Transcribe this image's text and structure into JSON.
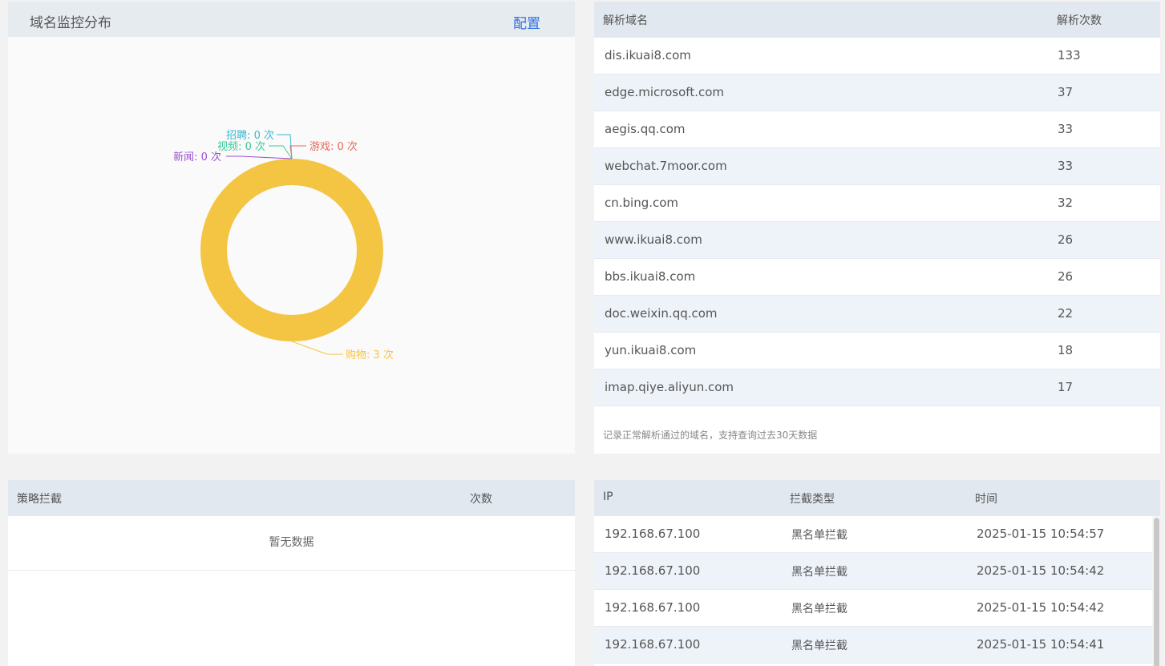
{
  "chart_panel": {
    "title": "域名监控分布",
    "config_label": "配置"
  },
  "chart_data": {
    "type": "pie",
    "donut": true,
    "slices": [
      {
        "name": "购物",
        "value": 3,
        "label": "购物: 3 次",
        "color": "#f4c542"
      },
      {
        "name": "游戏",
        "value": 0,
        "label": "游戏: 0 次",
        "color": "#e8685a"
      },
      {
        "name": "招聘",
        "value": 0,
        "label": "招聘: 0 次",
        "color": "#3bb6d6"
      },
      {
        "name": "视频",
        "value": 0,
        "label": "视频: 0 次",
        "color": "#3cc99a"
      },
      {
        "name": "新闻",
        "value": 0,
        "label": "新闻: 0 次",
        "color": "#9b4fd1"
      }
    ]
  },
  "domain_table": {
    "headers": [
      "解析域名",
      "解析次数"
    ],
    "rows": [
      {
        "domain": "dis.ikuai8.com",
        "count": "133"
      },
      {
        "domain": "edge.microsoft.com",
        "count": "37"
      },
      {
        "domain": "aegis.qq.com",
        "count": "33"
      },
      {
        "domain": "webchat.7moor.com",
        "count": "33"
      },
      {
        "domain": "cn.bing.com",
        "count": "32"
      },
      {
        "domain": "www.ikuai8.com",
        "count": "26"
      },
      {
        "domain": "bbs.ikuai8.com",
        "count": "26"
      },
      {
        "domain": "doc.weixin.qq.com",
        "count": "22"
      },
      {
        "domain": "yun.ikuai8.com",
        "count": "18"
      },
      {
        "domain": "imap.qiye.aliyun.com",
        "count": "17"
      }
    ],
    "note": "记录正常解析通过的域名，支持查询过去30天数据"
  },
  "policy_table": {
    "headers": [
      "策略拦截",
      "次数"
    ],
    "empty_text": "暂无数据"
  },
  "block_table": {
    "headers": [
      "IP",
      "拦截类型",
      "时间"
    ],
    "rows": [
      {
        "ip": "192.168.67.100",
        "type": "黑名单拦截",
        "time": "2025-01-15 10:54:57"
      },
      {
        "ip": "192.168.67.100",
        "type": "黑名单拦截",
        "time": "2025-01-15 10:54:42"
      },
      {
        "ip": "192.168.67.100",
        "type": "黑名单拦截",
        "time": "2025-01-15 10:54:42"
      },
      {
        "ip": "192.168.67.100",
        "type": "黑名单拦截",
        "time": "2025-01-15 10:54:41"
      }
    ]
  }
}
